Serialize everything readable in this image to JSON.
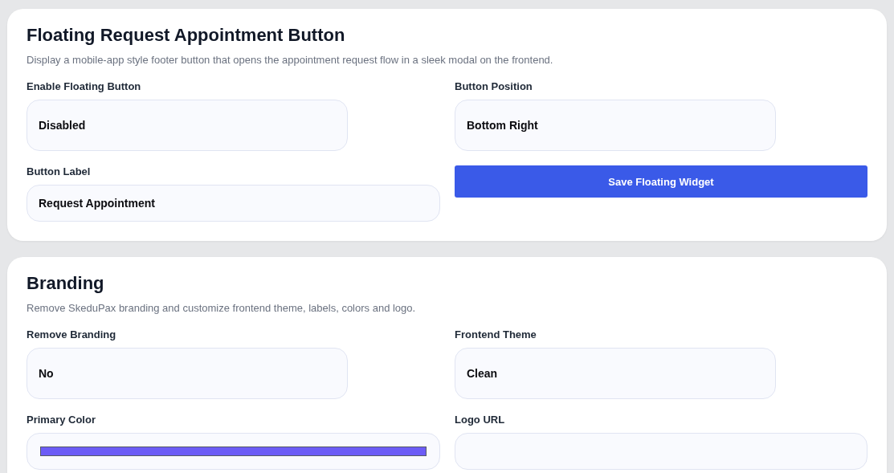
{
  "sections": [
    {
      "title": "Floating Request Appointment Button",
      "description": "Display a mobile-app style footer button that opens the appointment request flow in a sleek modal on the frontend.",
      "fields": [
        {
          "kind": "select",
          "label": "Enable Floating Button",
          "value": "Disabled"
        },
        {
          "kind": "select",
          "label": "Button Position",
          "value": "Bottom Right"
        },
        {
          "kind": "text",
          "label": "Button Label",
          "value": "Request Appointment"
        },
        {
          "kind": "button",
          "label": "Save Floating Widget"
        }
      ]
    },
    {
      "title": "Branding",
      "description": "Remove SkeduPax branding and customize frontend theme, labels, colors and logo.",
      "fields": [
        {
          "kind": "select",
          "label": "Remove Branding",
          "value": "No"
        },
        {
          "kind": "select",
          "label": "Frontend Theme",
          "value": "Clean"
        },
        {
          "kind": "color",
          "label": "Primary Color",
          "color": "#6c5cf6"
        },
        {
          "kind": "text",
          "label": "Logo URL"
        }
      ]
    }
  ]
}
